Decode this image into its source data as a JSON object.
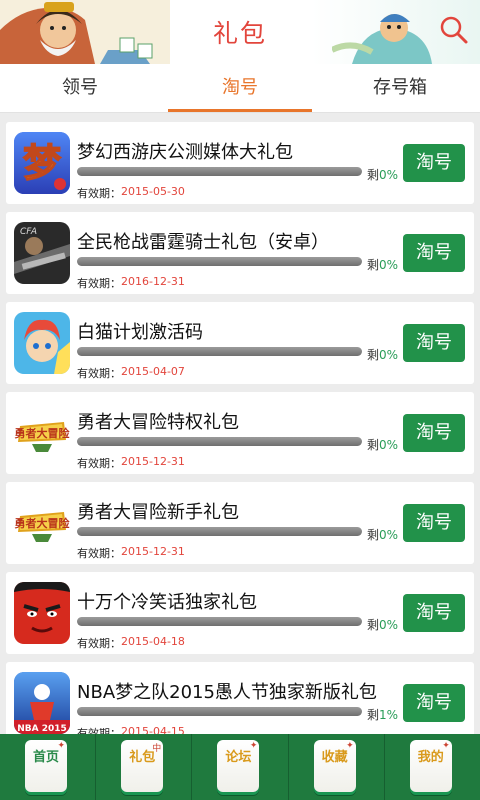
{
  "header": {
    "title": "礼包",
    "search_icon": "search-icon"
  },
  "tabs": [
    {
      "label": "领号",
      "active": false
    },
    {
      "label": "淘号",
      "active": true
    },
    {
      "label": "存号箱",
      "active": false
    }
  ],
  "list": {
    "expire_label": "有效期：",
    "remain_label": "剩",
    "action_label": "淘号",
    "items": [
      {
        "title": "梦幻西游庆公测媒体大礼包",
        "expire": "2015-05-30",
        "remain_pct": "0%",
        "icon": "menghuan-xiyou-icon"
      },
      {
        "title": "全民枪战雷霆骑士礼包（安卓）",
        "expire": "2016-12-31",
        "remain_pct": "0%",
        "icon": "quanmin-qiangzhan-icon"
      },
      {
        "title": "白猫计划激活码",
        "expire": "2015-04-07",
        "remain_pct": "0%",
        "icon": "baimao-jihua-icon"
      },
      {
        "title": "勇者大冒险特权礼包",
        "expire": "2015-12-31",
        "remain_pct": "0%",
        "icon": "yongzhe-damaoxian-icon"
      },
      {
        "title": "勇者大冒险新手礼包",
        "expire": "2015-12-31",
        "remain_pct": "0%",
        "icon": "yongzhe-damaoxian-icon"
      },
      {
        "title": "十万个冷笑话独家礼包",
        "expire": "2015-04-18",
        "remain_pct": "0%",
        "icon": "shiwange-lengxiaohua-icon"
      },
      {
        "title": "NBA梦之队2015愚人节独家新版礼包",
        "expire": "2015-04-15",
        "remain_pct": "1%",
        "icon": "nba-mengzhidui-icon"
      }
    ]
  },
  "bottom_nav": [
    {
      "label": "首页"
    },
    {
      "label": "礼包"
    },
    {
      "label": "论坛"
    },
    {
      "label": "收藏"
    },
    {
      "label": "我的"
    }
  ],
  "colors": {
    "accent": "#e8752b",
    "button": "#22924a",
    "title": "#e2453c",
    "nav": "#1f7a3e"
  }
}
